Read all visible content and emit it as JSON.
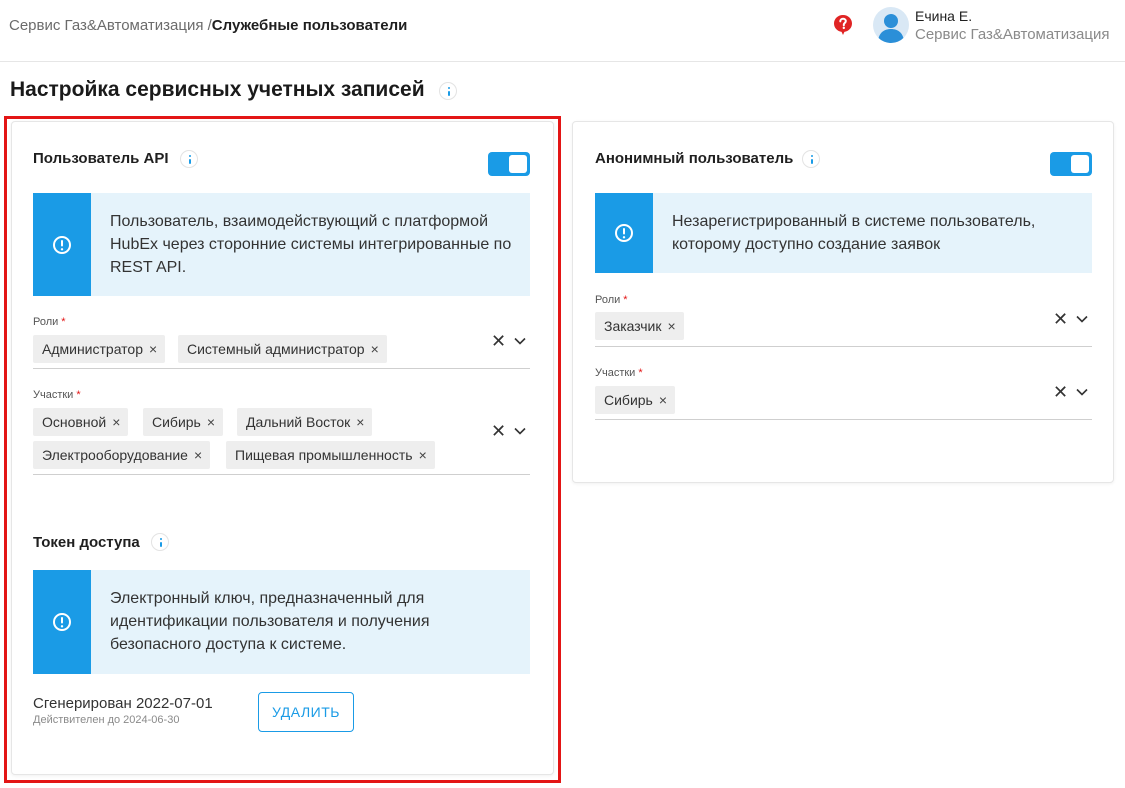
{
  "header": {
    "breadcrumb_root": "Сервис Газ&Автоматизация /",
    "breadcrumb_current": "Служебные пользователи",
    "user_name": "Ечина Е.",
    "user_org": "Сервис Газ&Автоматизация"
  },
  "page": {
    "title": "Настройка сервисных учетных записей"
  },
  "api_user": {
    "title": "Пользователь API",
    "enabled": true,
    "info": "Пользователь, взаимодействующий с платформой HubEx через сторонние системы интегрированные по REST API.",
    "roles_label": "Роли",
    "roles": [
      "Администратор",
      "Системный администратор"
    ],
    "sites_label": "Участки",
    "sites": [
      "Основной",
      "Сибирь",
      "Дальний Восток",
      "Электрооборудование",
      "Пищевая промышленность"
    ]
  },
  "token": {
    "title": "Токен доступа",
    "info": "Электронный ключ, предназначенный для идентификации пользователя и получения безопасного доступа к системе.",
    "generated": "Сгенерирован 2022-07-01",
    "valid_until": "Действителен до 2024-06-30",
    "delete_label": "УДАЛИТЬ"
  },
  "anon_user": {
    "title": "Анонимный пользователь",
    "enabled": true,
    "info": "Незарегистрированный в системе пользователь, которому доступно создание заявок",
    "roles_label": "Роли",
    "roles": [
      "Заказчик"
    ],
    "sites_label": "Участки",
    "sites": [
      "Сибирь"
    ]
  },
  "symbols": {
    "required": "*",
    "remove": "×",
    "clear": "✕"
  },
  "colors": {
    "accent": "#1a9be6",
    "info_bg": "#e5f3fb",
    "required": "#e31515",
    "highlight": "#e31515"
  }
}
